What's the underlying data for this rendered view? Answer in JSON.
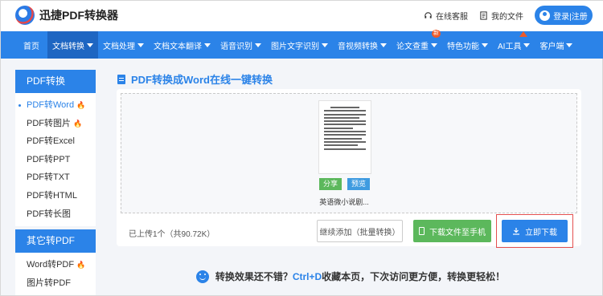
{
  "header": {
    "brand": "迅捷PDF转换器",
    "service_label": "在线客服",
    "my_files_label": "我的文件",
    "login_label": "登录|注册"
  },
  "nav": {
    "items": [
      {
        "label": "首页",
        "caret": false
      },
      {
        "label": "文档转换",
        "caret": true
      },
      {
        "label": "文档处理",
        "caret": true
      },
      {
        "label": "文档文本翻译",
        "caret": true
      },
      {
        "label": "语音识别",
        "caret": true
      },
      {
        "label": "图片文字识别",
        "caret": true
      },
      {
        "label": "音视频转换",
        "caret": true
      },
      {
        "label": "论文查重",
        "caret": true,
        "badge": "新"
      },
      {
        "label": "特色功能",
        "caret": true
      },
      {
        "label": "AI工具",
        "caret": true
      },
      {
        "label": "客户端",
        "caret": true
      }
    ]
  },
  "sidebar": {
    "section1_title": "PDF转换",
    "section1_items": [
      {
        "label": "PDF转Word",
        "hot": true
      },
      {
        "label": "PDF转图片",
        "hot": true
      },
      {
        "label": "PDF转Excel"
      },
      {
        "label": "PDF转PPT"
      },
      {
        "label": "PDF转TXT"
      },
      {
        "label": "PDF转HTML"
      },
      {
        "label": "PDF转长图"
      }
    ],
    "section2_title": "其它转PDF",
    "section2_items": [
      {
        "label": "Word转PDF",
        "hot": true
      },
      {
        "label": "图片转PDF"
      }
    ],
    "hot_icon": "🔥"
  },
  "main": {
    "title": "PDF转换成Word在线一键转换",
    "file": {
      "share_label": "分享",
      "preview_label": "预览",
      "name": "英语微小说剧..."
    },
    "status_text": "已上传1个（共90.72K）",
    "continue_label": "继续添加（批量转换）",
    "phone_label": "下载文件至手机",
    "download_label": "立即下载"
  },
  "footer": {
    "tip_prefix": "转换效果还不错？",
    "tip_highlight": "Ctrl+D",
    "tip_suffix": "收藏本页，下次访问更方便，转换更轻松！"
  },
  "colors": {
    "primary": "#2b83e8",
    "green": "#5cb85c",
    "hot": "#f05a28",
    "highlight_box": "#e45050"
  }
}
